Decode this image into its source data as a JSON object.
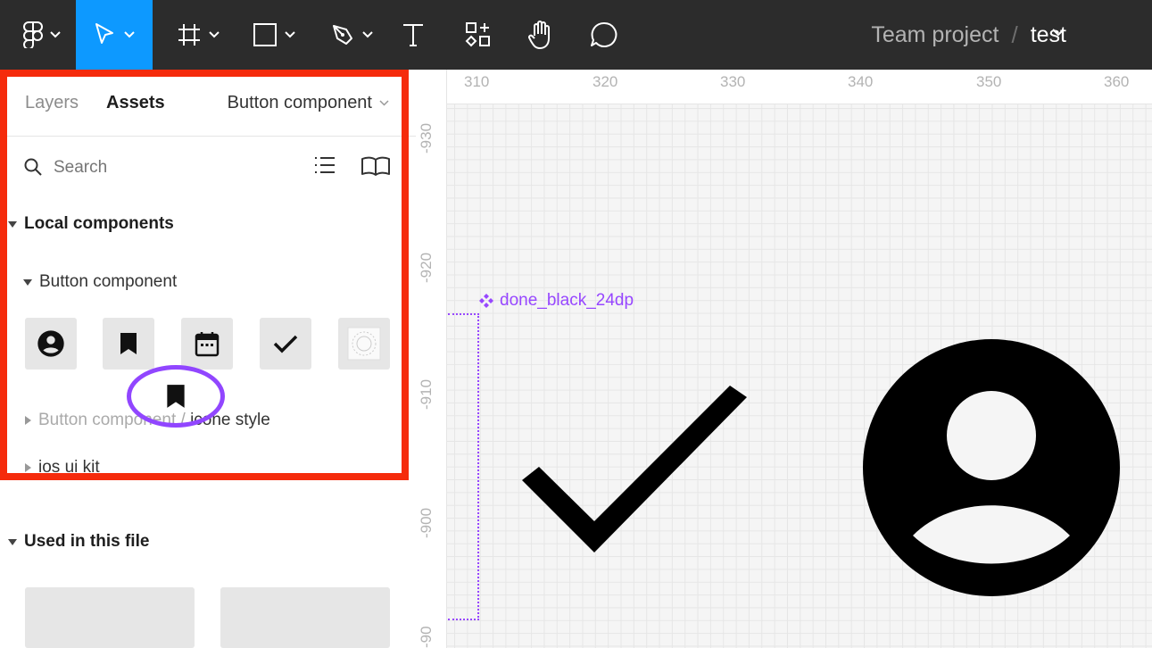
{
  "toolbar": {
    "tools": [
      {
        "name": "main-menu",
        "icon": "figma-logo-icon",
        "active": false
      },
      {
        "name": "move",
        "icon": "pointer-icon",
        "active": true
      },
      {
        "name": "frame",
        "icon": "frame-icon",
        "active": false
      },
      {
        "name": "shape",
        "icon": "rectangle-icon",
        "active": false
      },
      {
        "name": "pen",
        "icon": "pen-icon",
        "active": false
      },
      {
        "name": "text",
        "icon": "text-icon",
        "active": false
      },
      {
        "name": "resources",
        "icon": "resources-icon",
        "active": false
      },
      {
        "name": "hand",
        "icon": "hand-icon",
        "active": false
      },
      {
        "name": "comment",
        "icon": "comment-icon",
        "active": false
      }
    ],
    "breadcrumb": {
      "team": "Team project",
      "separator": "/",
      "file": "test"
    },
    "colors": {
      "bar": "#2c2c2c",
      "active_tool": "#0d99ff"
    }
  },
  "left_panel": {
    "tabs": {
      "layers": "Layers",
      "assets": "Assets"
    },
    "library_select": "Button component",
    "search": {
      "placeholder": "Search"
    },
    "local_components": "Local components",
    "button_component": "Button component",
    "tiles": [
      "account-circle-icon",
      "bookmark-icon",
      "calendar-icon",
      "check-icon",
      "placeholder-icon"
    ],
    "collapsed_groups": {
      "icone_style_prefix": "Button component / ",
      "icone_style_label": "icone style",
      "ios_ui_kit": "ios ui kit"
    },
    "used_in_file": "Used in this file",
    "highlight_color": "#f52b0c",
    "drag_color": "#9146ff"
  },
  "canvas": {
    "ruler_top": [
      "310",
      "320",
      "330",
      "340",
      "350",
      "360"
    ],
    "ruler_left": [
      "-930",
      "-920",
      "-910",
      "-900",
      "-90"
    ],
    "component_label": "done_black_24dp",
    "accent": "#9747ff"
  }
}
